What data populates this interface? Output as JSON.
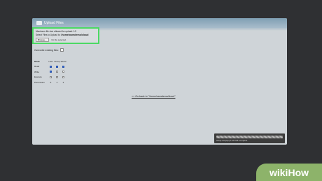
{
  "window": {
    "title": "Upload Files"
  },
  "upload": {
    "max_size_line": "Maximum file size allowed for upload: 1G",
    "select_prefix": "Select Files to Upload to:",
    "path": "/home/osmdemo/cloud",
    "browse_label": "Browse...",
    "no_file_label": "No file selected."
  },
  "overwrite_label": "Overwrite existing files:",
  "permissions": {
    "headers": [
      "Mode",
      "User",
      "Group",
      "World"
    ],
    "rows": [
      {
        "label": "Read",
        "checked": [
          true,
          true,
          true
        ]
      },
      {
        "label": "Write",
        "checked": [
          true,
          false,
          false
        ]
      },
      {
        "label": "Execute",
        "checked": [
          false,
          false,
          false
        ]
      },
      {
        "label": "Permission",
        "values": [
          "6",
          "4",
          "4"
        ]
      }
    ]
  },
  "back_link": "<< Go back to \"/home/osmdemo/cloud\"",
  "status": {
    "text": "setup.exe(zip) 0.4% KB complete",
    "progress": 1.0
  },
  "watermark": {
    "wiki": "wiki",
    "how": "How"
  },
  "colors": {
    "highlight": "#4cd964",
    "watermark_bg": "#8db36a"
  }
}
